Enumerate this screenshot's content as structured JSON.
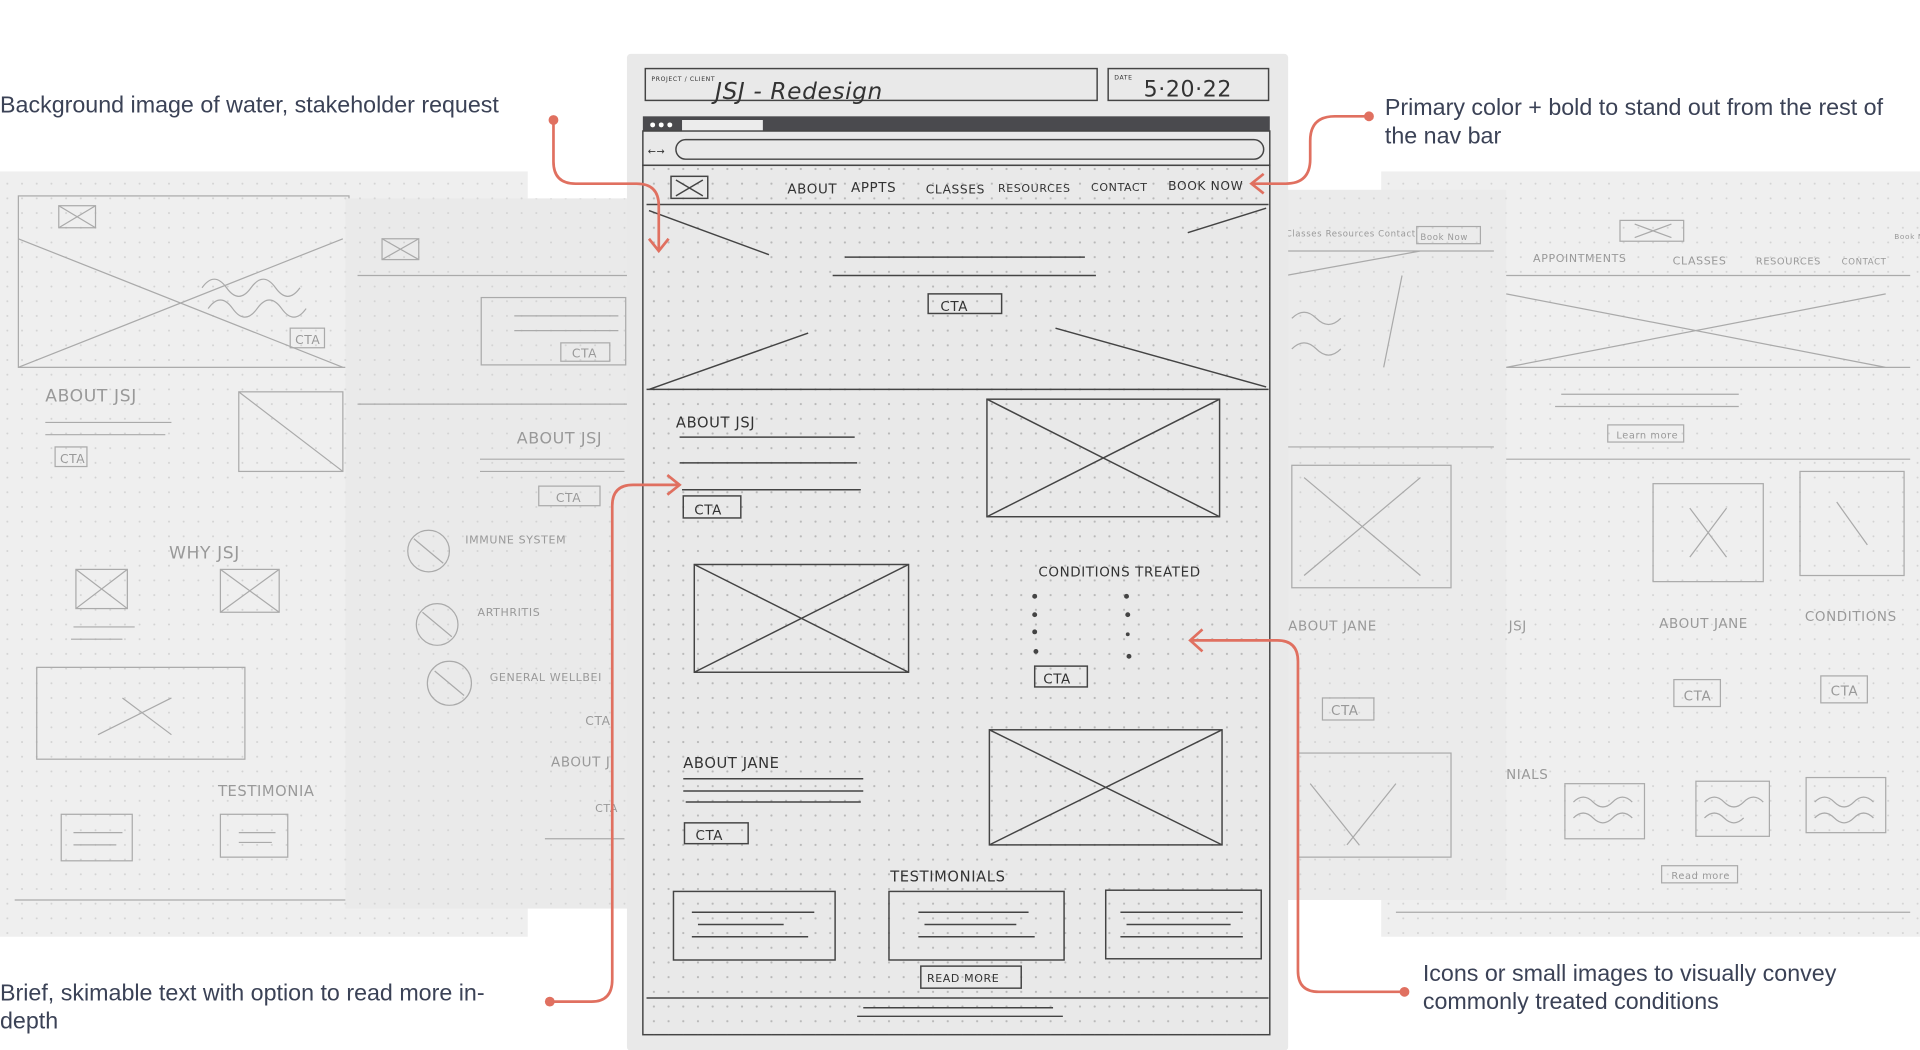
{
  "annotations": {
    "top_left": "Background image of water, stakeholder request",
    "top_right_line1": "Primary color + bold to stand out from the rest of",
    "top_right_line2": "the nav bar",
    "bottom_left_line1": "Brief, skimable text with option to read more in-",
    "bottom_left_line2": "depth",
    "bottom_right_line1": "Icons or small images to visually convey",
    "bottom_right_line2": "commonly treated conditions"
  },
  "colors": {
    "accent": "#e07060",
    "text": "#3b4256",
    "paper": "#ececec"
  },
  "main_sketch": {
    "project_label": "PROJECT / CLIENT",
    "project": "JSJ - Redesign",
    "date_label": "DATE",
    "date": "5·20·22",
    "browser_nav": "←→",
    "nav": [
      "ABOUT",
      "APPTS",
      "CLASSES",
      "RESOURCES",
      "CONTACT",
      "BOOK NOW"
    ],
    "hero_cta": "CTA",
    "about_title": "ABOUT JSJ",
    "about_cta": "CTA",
    "conditions_title": "CONDITIONS TREATED",
    "conditions_cta": "CTA",
    "jane_title": "ABOUT JANE",
    "jane_cta": "CTA",
    "testimonials_title": "TESTIMONIALS",
    "read_more": "READ MORE"
  },
  "left_sketch_1": {
    "cta": "CTA",
    "about": "ABOUT JSJ",
    "about_cta": "CTA",
    "why": "WHY JSJ",
    "testimonials": "TESTIMONIA"
  },
  "left_sketch_2": {
    "cta": "CTA",
    "about": "ABOUT JSJ",
    "about_cta": "CTA",
    "items": [
      "IMMUNE SYSTEM",
      "ARTHRITIS",
      "GENERAL WELLBEI"
    ],
    "cta2": "CTA",
    "about2": "ABOUT J",
    "cta3": "CTA"
  },
  "right_sketch_1": {
    "nav": "Classes  Resources  Contact",
    "book": "Book Now",
    "about_jane": "ABOUT JANE",
    "cta": "CTA"
  },
  "right_sketch_2": {
    "nav": [
      "APPOINTMENTS",
      "CLASSES",
      "RESOURCES",
      "CONTACT"
    ],
    "book": "Book Now",
    "learn_more": "Learn more",
    "jsj": "JSJ",
    "about_jane": "ABOUT JANE",
    "conditions": "CONDITIONS",
    "cta1": "CTA",
    "cta2": "CTA",
    "testimonials": "NIALS",
    "read_more": "Read more"
  }
}
